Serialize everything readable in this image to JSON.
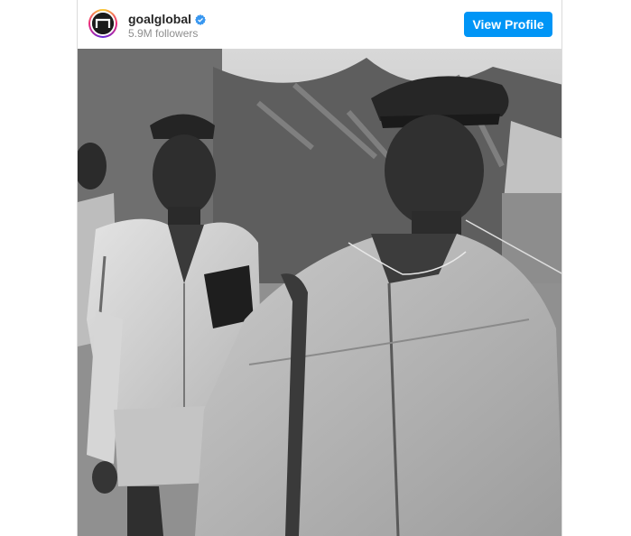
{
  "post": {
    "username": "goalglobal",
    "verified": true,
    "followers_text": "5.9M followers",
    "view_profile_label": "View Profile",
    "accent_color": "#0095f6",
    "verified_color": "#3897f0"
  },
  "icons": {
    "verified": "verified-badge-icon",
    "avatar": "goal-logo"
  },
  "media": {
    "type": "photo",
    "tone": "black-and-white"
  }
}
